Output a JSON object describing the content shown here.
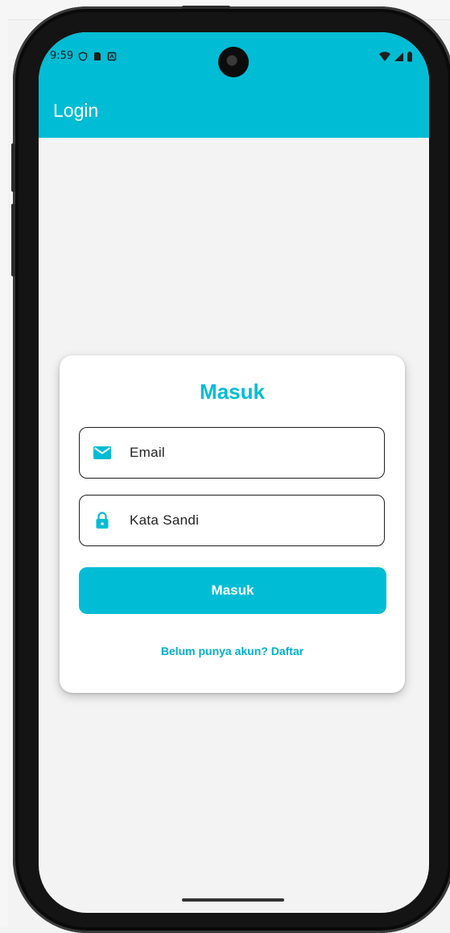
{
  "status_bar": {
    "time": "9:59"
  },
  "app_bar": {
    "title": "Login"
  },
  "login_card": {
    "title": "Masuk",
    "email_placeholder": "Email",
    "password_placeholder": "Kata Sandi",
    "submit_label": "Masuk",
    "register_link": "Belum punya akun? Daftar"
  },
  "colors": {
    "primary": "#00bcd4",
    "background": "#f3f3f3",
    "card": "#ffffff"
  },
  "icons": {
    "email": "mail-icon",
    "password": "lock-icon"
  }
}
